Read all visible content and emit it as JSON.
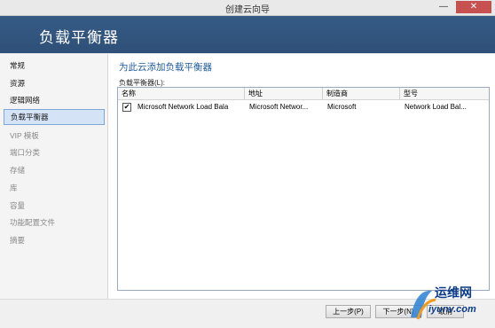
{
  "window": {
    "title": "创建云向导",
    "min": "—",
    "close": "✕"
  },
  "header": {
    "title": "负载平衡器"
  },
  "sidebar": {
    "items": [
      {
        "label": "常规"
      },
      {
        "label": "资源"
      },
      {
        "label": "逻辑网络"
      },
      {
        "label": "负载平衡器"
      },
      {
        "label": "VIP 模板"
      },
      {
        "label": "端口分类"
      },
      {
        "label": "存储"
      },
      {
        "label": "库"
      },
      {
        "label": "容量"
      },
      {
        "label": "功能配置文件"
      },
      {
        "label": "摘要"
      }
    ]
  },
  "main": {
    "heading": "为此云添加负载平衡器",
    "list_label": "负载平衡器(L):",
    "columns": [
      "名称",
      "地址",
      "制造商",
      "型号"
    ],
    "rows": [
      {
        "checked": "✔",
        "name": "Microsoft Network Load Bala",
        "address": "Microsoft Networ...",
        "manufacturer": "Microsoft",
        "model": "Network Load Bal..."
      }
    ]
  },
  "footer": {
    "prev": "上一步(P)",
    "next": "下一步(N)",
    "cancel": "取消"
  },
  "watermark": {
    "name": "运维网",
    "url": "iyunv.com"
  }
}
